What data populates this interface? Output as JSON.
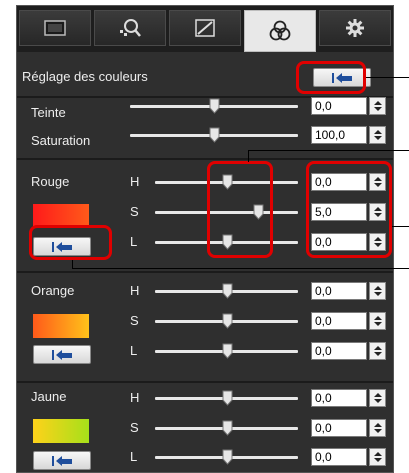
{
  "tabs": [
    {
      "icon": "image-view-icon"
    },
    {
      "icon": "color-picker-icon"
    },
    {
      "icon": "tone-curve-icon"
    },
    {
      "icon": "color-circles-icon",
      "active": true
    },
    {
      "icon": "settings-gear-icon"
    }
  ],
  "header": {
    "title": "Réglage des couleurs"
  },
  "global": {
    "teinte": {
      "label": "Teinte",
      "value": "0,0",
      "slider": 0.5
    },
    "saturation": {
      "label": "Saturation",
      "value": "100,0",
      "slider": 0.5
    }
  },
  "hsl_labels": {
    "h": "H",
    "s": "S",
    "l": "L"
  },
  "colors": [
    {
      "name": "Rouge",
      "swatch_from": "#ff1a1a",
      "swatch_to": "#ff5a1a",
      "h": {
        "value": "0,0",
        "slider": 0.5
      },
      "s": {
        "value": "5,0",
        "slider": 0.72
      },
      "l": {
        "value": "0,0",
        "slider": 0.5
      }
    },
    {
      "name": "Orange",
      "swatch_from": "#ff5a1a",
      "swatch_to": "#ffc21a",
      "h": {
        "value": "0,0",
        "slider": 0.5
      },
      "s": {
        "value": "0,0",
        "slider": 0.5
      },
      "l": {
        "value": "0,0",
        "slider": 0.5
      }
    },
    {
      "name": "Jaune",
      "swatch_from": "#ffd21a",
      "swatch_to": "#a6e01a",
      "h": {
        "value": "0,0",
        "slider": 0.5
      },
      "s": {
        "value": "0,0",
        "slider": 0.5
      },
      "l": {
        "value": "0,0",
        "slider": 0.5
      }
    }
  ],
  "colors_ui": {
    "highlight": "#e00000",
    "panel_bg": "#2f2f2f",
    "track": "#e8e8e8"
  }
}
